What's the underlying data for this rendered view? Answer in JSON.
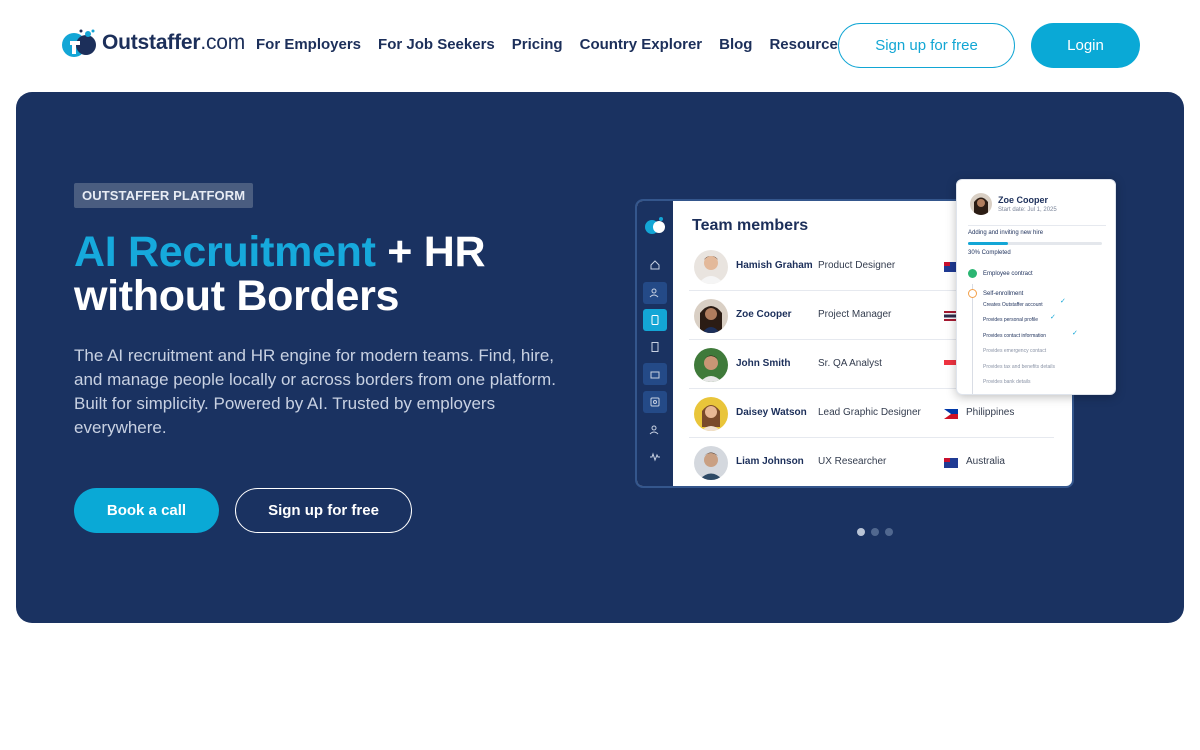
{
  "header": {
    "logo_text": "Outstaffer",
    "logo_domain": ".com",
    "nav": [
      "For Employers",
      "For Job Seekers",
      "Pricing",
      "Country Explorer",
      "Blog",
      "Resources"
    ],
    "signup_label": "Sign up for free",
    "login_label": "Login"
  },
  "hero": {
    "badge": "OUTSTAFFER PLATFORM",
    "headline_accent": "AI Recruitment",
    "headline_rest_1": " + HR",
    "headline_rest_2": "without Borders",
    "description": "The AI recruitment and HR engine for modern teams. Find, hire, and manage people locally or across borders from one platform. Built for simplicity. Powered by AI. Trusted by employers everywhere.",
    "book_label": "Book a call",
    "signup_label": "Sign up for free"
  },
  "mockup": {
    "title": "Team members",
    "members": [
      {
        "name": "Hamish Graham",
        "role": "Product Designer",
        "country": ""
      },
      {
        "name": "Zoe Cooper",
        "role": "Project Manager",
        "country": ""
      },
      {
        "name": "John Smith",
        "role": "Sr. QA Analyst",
        "country": ""
      },
      {
        "name": "Daisey Watson",
        "role": "Lead Graphic Designer",
        "country": "Philippines"
      },
      {
        "name": "Liam Johnson",
        "role": "UX Researcher",
        "country": "Australia"
      }
    ],
    "popup": {
      "name": "Zoe Cooper",
      "start": "Start date: Jul 1, 2025",
      "task": "Adding and inviting new hire",
      "progress_pct": 30,
      "progress_label": "30% Completed",
      "step1": "Employee contract",
      "step2": "Self-enrollment",
      "substeps": [
        "Creates Outstaffer account",
        "Provides personal profile",
        "Provides contact information",
        "Provides emergency contact",
        "Provides tax and benefits details",
        "Provides bank details"
      ]
    }
  },
  "carousel": {
    "count": 3,
    "active": 1
  },
  "colors": {
    "navy": "#1a3261",
    "accent": "#0aa9d6",
    "white": "#ffffff"
  }
}
